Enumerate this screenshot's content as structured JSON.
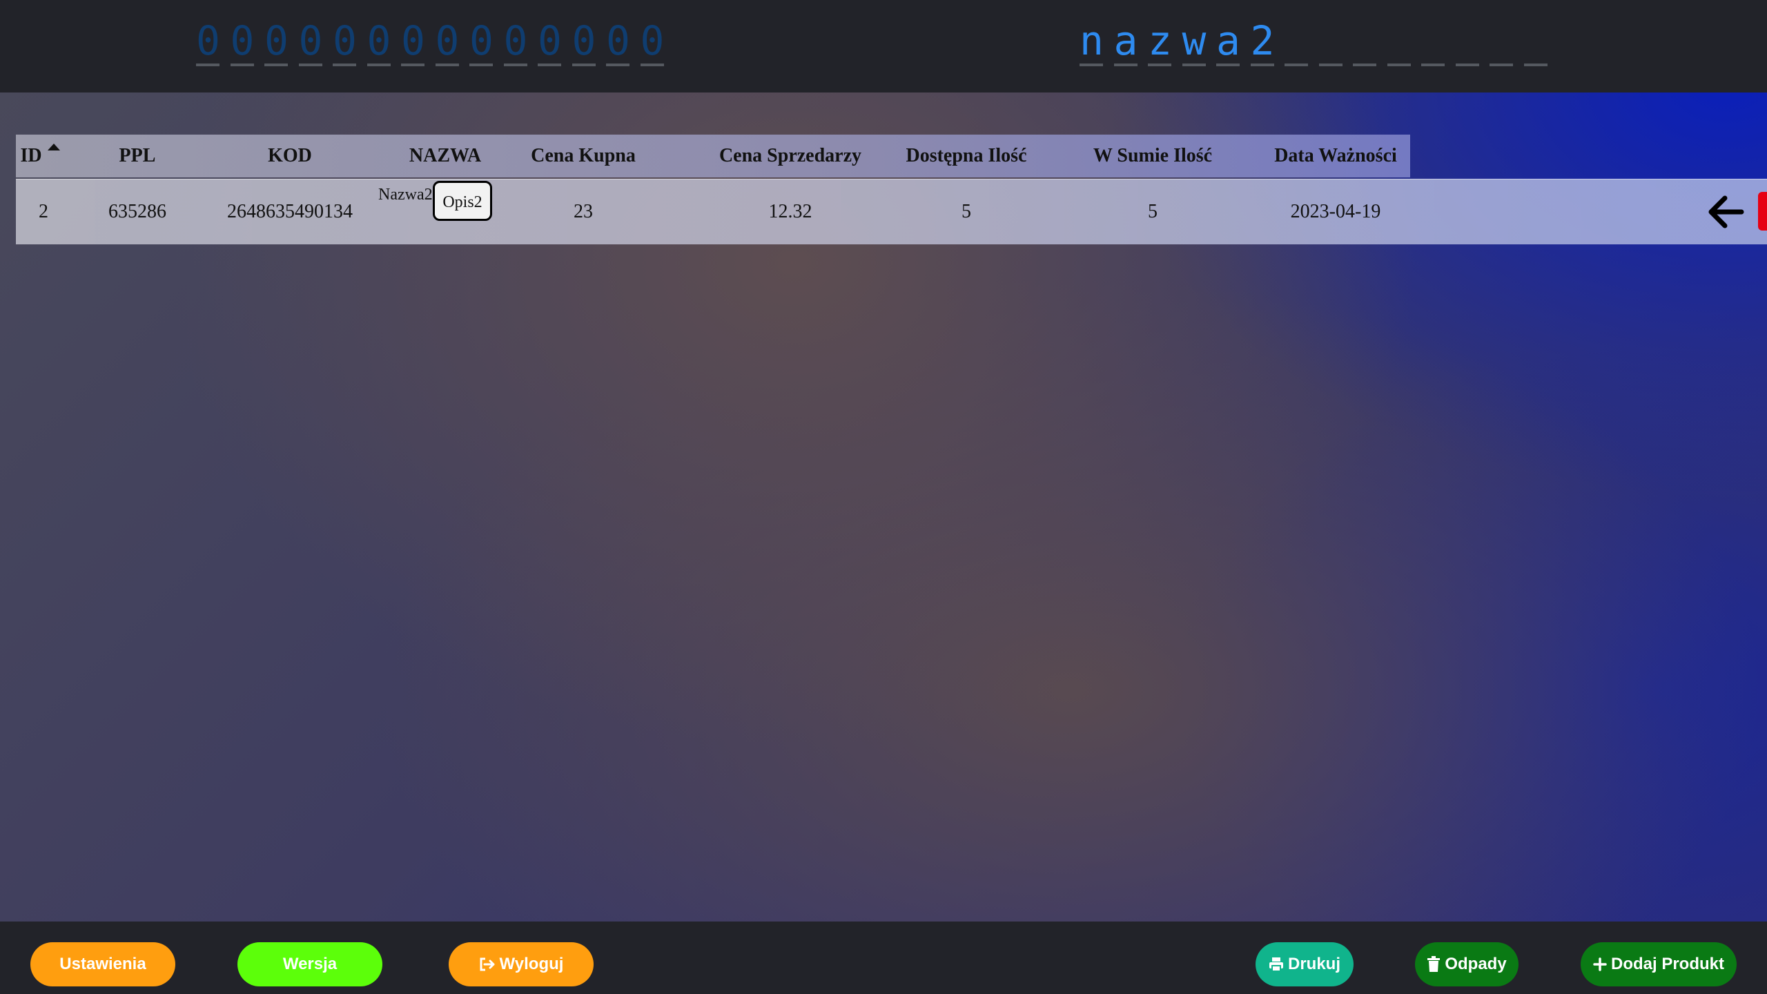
{
  "top": {
    "code_chars": [
      "0",
      "0",
      "0",
      "0",
      "0",
      "0",
      "0",
      "0",
      "0",
      "0",
      "0",
      "0",
      "0",
      "0"
    ],
    "name_chars": [
      "n",
      "a",
      "z",
      "w",
      "a",
      "2",
      "",
      "",
      "",
      "",
      "",
      "",
      "",
      ""
    ]
  },
  "table": {
    "headers": {
      "id": "ID",
      "ppl": "PPL",
      "kod": "KOD",
      "nazwa": "NAZWA",
      "cena_kupna": "Cena Kupna",
      "cena_sprzedarzy": "Cena Sprzedarzy",
      "dostepna_ilosc": "Dostępna Ilość",
      "w_sumie_ilosc": "W Sumie Ilość",
      "data_waznosci": "Data Ważności"
    },
    "sort": {
      "column": "ID",
      "direction": "ascending",
      "icon": "sort-up-icon"
    },
    "rows": [
      {
        "id": "2",
        "ppl": "635286",
        "kod": "2648635490134",
        "nazwa": "Nazwa2",
        "opis_button": "Opis2",
        "cena_kupna": "23",
        "cena_sprzedarzy": "12.32",
        "dostepna_ilosc": "5",
        "w_sumie_ilosc": "5",
        "data_waznosci": "2023-04-19"
      }
    ],
    "row_actions": {
      "back_icon": "arrow-left-icon",
      "delete_color": "#e60012"
    }
  },
  "footer": {
    "ustawienia": "Ustawienia",
    "wersja": "Wersja",
    "wyloguj": "Wyloguj",
    "drukuj": "Drukuj",
    "odpady": "Odpady",
    "dodaj_produkt": "Dodaj Produkt"
  },
  "colors": {
    "topbar": "#222329",
    "code_digits": "#0f3d70",
    "name_chars": "#2e8bf0",
    "ustawienia": "#ff9e0f",
    "wersja": "#5cff0a",
    "wyloguj": "#ff9e0f",
    "drukuj": "#10b48c",
    "odpady": "#0a7a14",
    "dodaj_produkt": "#0a7a14"
  }
}
